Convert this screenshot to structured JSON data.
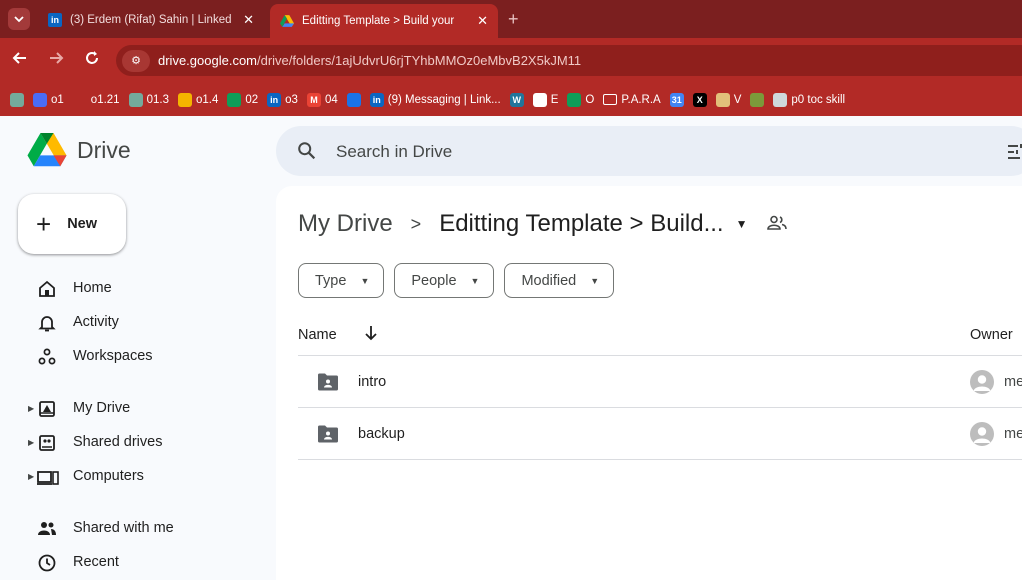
{
  "browser": {
    "tabs": [
      {
        "title": "(3) Erdem (Rifat) Sahin | Linked",
        "icon": "linkedin-icon",
        "active": false
      },
      {
        "title": "Editting Template > Build your",
        "icon": "google-drive-icon",
        "active": true
      }
    ],
    "url_host": "drive.google.com",
    "url_path": "/drive/folders/1ajUdvrU6rjTYhbMMOz0eMbvB2X5kJM11",
    "bookmarks": [
      {
        "label": "",
        "icon": "openai-icon"
      },
      {
        "label": "o1",
        "icon": "bookmark-icon"
      },
      {
        "label": "o1.21",
        "icon": "key-icon"
      },
      {
        "label": "01.3",
        "icon": "openai-icon"
      },
      {
        "label": "o1.4",
        "icon": "google-drive-icon"
      },
      {
        "label": "02",
        "icon": "sheets-icon"
      },
      {
        "label": "o3",
        "icon": "linkedin-icon"
      },
      {
        "label": "04",
        "icon": "gmail-icon"
      },
      {
        "label": "",
        "icon": "forms-icon"
      },
      {
        "label": "(9) Messaging | Link...",
        "icon": "linkedin-icon"
      },
      {
        "label": "",
        "icon": "wordpress-icon"
      },
      {
        "label": "E",
        "icon": "wix-icon"
      },
      {
        "label": "O",
        "icon": "sheets-icon"
      },
      {
        "label": "P.A.R.A",
        "icon": "folder-icon"
      },
      {
        "label": "",
        "icon": "calendar-icon"
      },
      {
        "label": "",
        "icon": "x-icon"
      },
      {
        "label": "V",
        "icon": "pen-icon"
      },
      {
        "label": "",
        "icon": "robot-icon"
      },
      {
        "label": "p0 toc skill",
        "icon": "cloud-icon"
      }
    ]
  },
  "drive": {
    "logo_text": "Drive",
    "search_placeholder": "Search in Drive",
    "new_label": "New",
    "nav": [
      {
        "label": "Home",
        "icon": "home-icon",
        "caret": false
      },
      {
        "label": "Activity",
        "icon": "bell-icon",
        "caret": false
      },
      {
        "label": "Workspaces",
        "icon": "workspaces-icon",
        "caret": false
      },
      {
        "label": "My Drive",
        "icon": "my-drive-icon",
        "caret": true
      },
      {
        "label": "Shared drives",
        "icon": "shared-drives-icon",
        "caret": true
      },
      {
        "label": "Computers",
        "icon": "computer-icon",
        "caret": true
      },
      {
        "label": "Shared with me",
        "icon": "people-icon",
        "caret": false
      },
      {
        "label": "Recent",
        "icon": "clock-icon",
        "caret": false
      }
    ],
    "breadcrumb": {
      "root": "My Drive",
      "current": "Editting Template > Build..."
    },
    "filters": [
      "Type",
      "People",
      "Modified"
    ],
    "columns": {
      "name": "Name",
      "owner": "Owner"
    },
    "files": [
      {
        "name": "intro",
        "owner": "me"
      },
      {
        "name": "backup",
        "owner": "me"
      }
    ]
  }
}
